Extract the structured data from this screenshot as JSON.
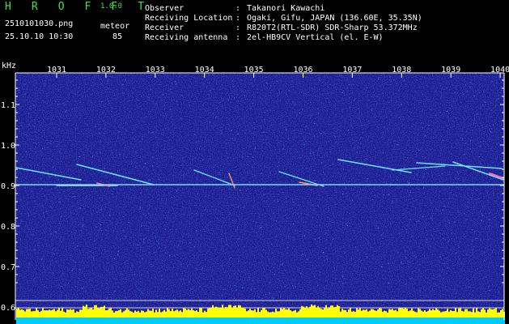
{
  "header": {
    "app_name": "H R O F F T",
    "app_version": "1.0.0",
    "filename": "2510101030.png",
    "datetime": "25.10.10 10:30",
    "count_label": "meteor",
    "count_value": "85",
    "info": [
      {
        "label": "Observer",
        "value": "Takanori Kawachi"
      },
      {
        "label": "Receiving Location",
        "value": "Ogaki, Gifu, JAPAN (136.60E, 35.35N)"
      },
      {
        "label": "Receiver",
        "value": "R820T2(RTL-SDR) SDR-Sharp 53.372MHz"
      },
      {
        "label": "Receiving antenna",
        "value": "2el-HB9CV Vertical (el. E-W)"
      }
    ],
    "separator": ":"
  },
  "spectrogram": {
    "y_unit": "kHz",
    "y_ticks": [
      "1.1",
      "1.0",
      "0.9",
      "0.8",
      "0.7",
      "0.6"
    ],
    "time_ticks": [
      "1031",
      "1032",
      "1033",
      "1034",
      "1035",
      "1036",
      "1037",
      "1038",
      "1039",
      "1040"
    ],
    "colors": {
      "background": "#1a1a8c",
      "carrier": "#7fd6e8",
      "echo": "#6fe0ff",
      "level_bar": "#ffff00",
      "level_base": "#00ccff",
      "axis": "#ffffff"
    }
  }
}
